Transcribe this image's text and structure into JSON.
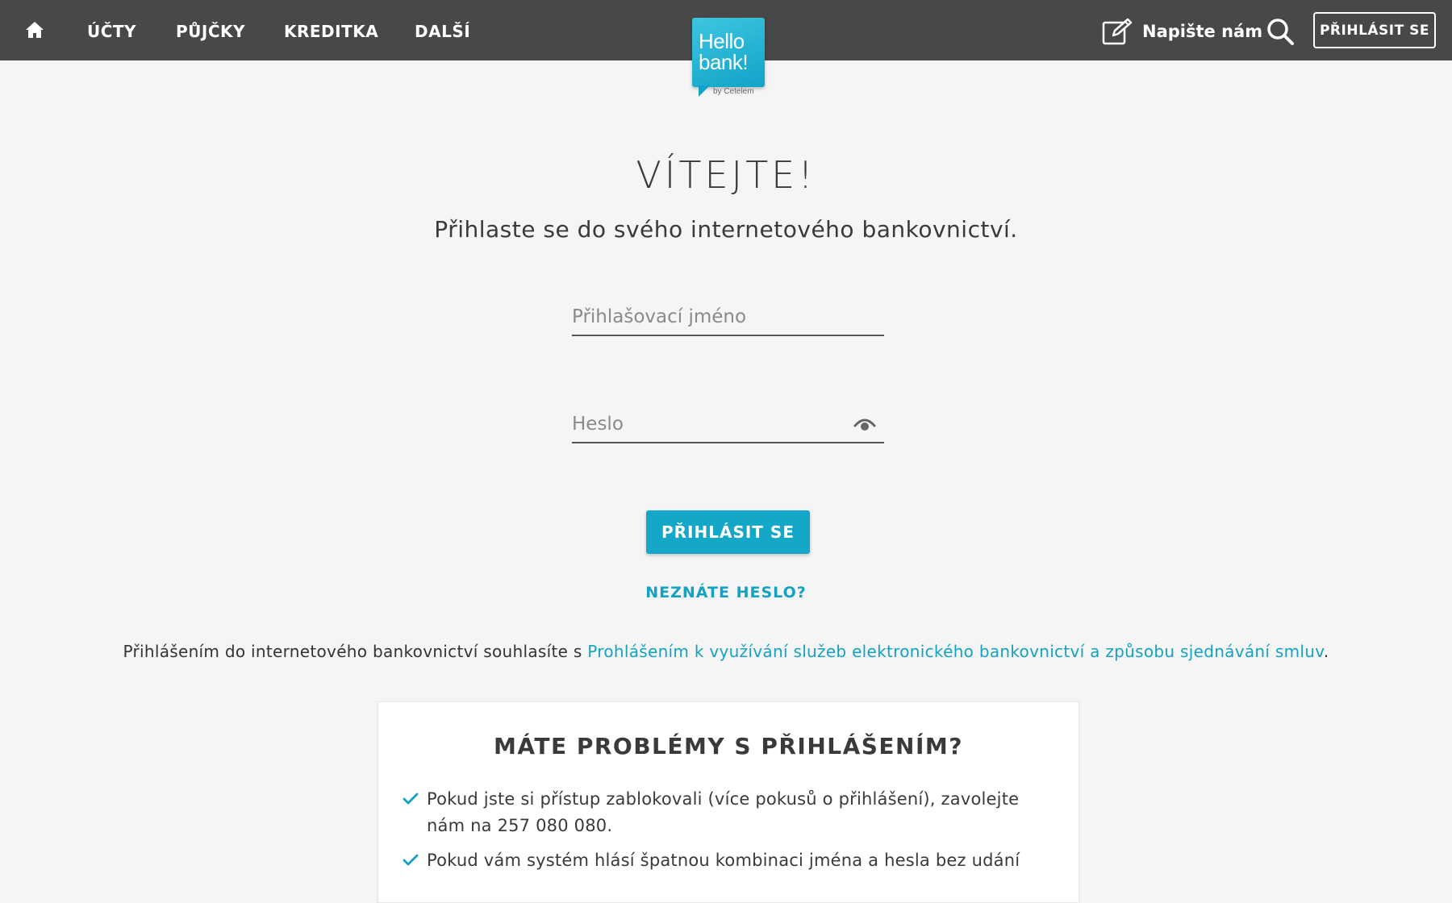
{
  "nav": {
    "items": [
      {
        "label": "ÚČTY"
      },
      {
        "label": "PŮJČKY"
      },
      {
        "label": "KREDITKA"
      },
      {
        "label": "DALŠÍ"
      }
    ],
    "write_us": "Napište nám",
    "login_top": "PŘIHLÁSIT SE"
  },
  "logo": {
    "line1": "Hello",
    "line2": "bank!",
    "sub": "by Cetelem"
  },
  "main": {
    "title": "VÍTEJTE!",
    "subtitle": "Přihlaste se do svého internetového bankovnictví.",
    "username_placeholder": "Přihlašovací jméno",
    "password_placeholder": "Heslo",
    "login_button": "PŘIHLÁSIT SE",
    "forgot": "NEZNÁTE HESLO?",
    "consent_prefix": "Přihlášením do internetového bankovnictví souhlasíte s ",
    "consent_link": "Prohlášením k využívání služeb elektronického bankovnictví a způsobu sjednávání smluv",
    "consent_suffix": "."
  },
  "problems": {
    "title": "MÁTE PROBLÉMY S PŘIHLÁŠENÍM?",
    "items": [
      "Pokud jste si přístup zablokovali (více pokusů o přihlášení), zavolejte nám na 257 080 080.",
      "Pokud vám systém hlásí špatnou kombinaci jména a hesla bez udání"
    ]
  },
  "colors": {
    "topbar": "#484848",
    "accent": "#14a7c8",
    "background": "#f5f5f5"
  }
}
